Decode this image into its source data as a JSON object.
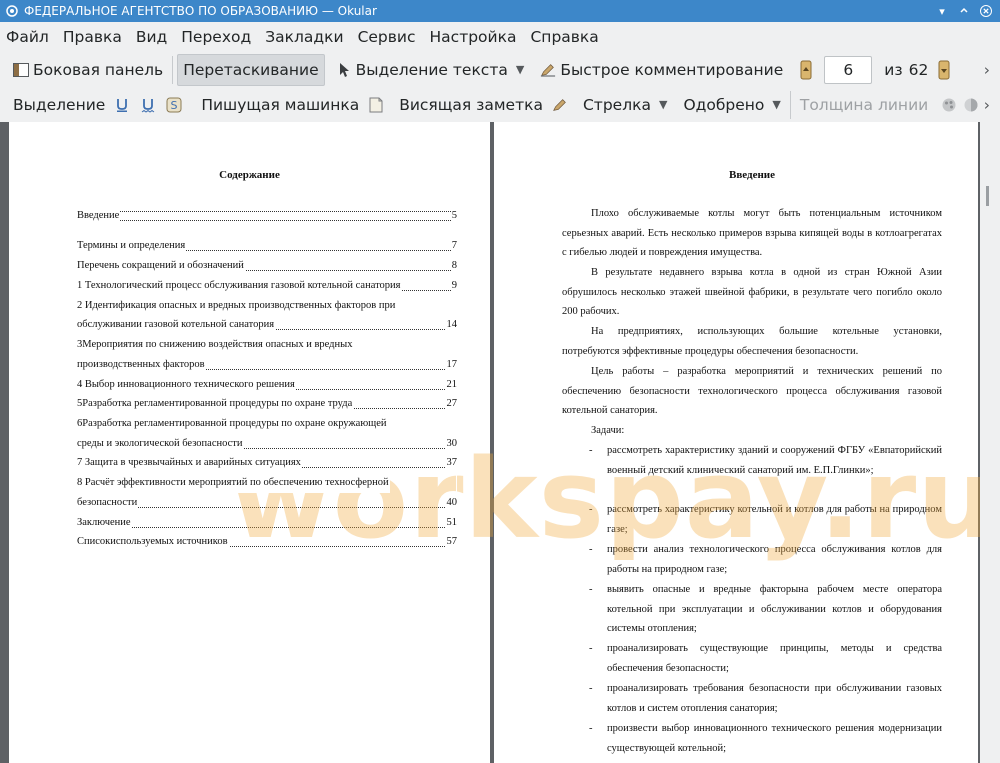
{
  "window": {
    "title": "ФЕДЕРАЛЬНОЕ АГЕНТСТВО ПО ОБРАЗОВАНИЮ — Okular"
  },
  "menu": [
    "Файл",
    "Правка",
    "Вид",
    "Переход",
    "Закладки",
    "Сервис",
    "Настройка",
    "Справка"
  ],
  "toolbar1": {
    "sidebar": "Боковая панель",
    "drag": "Перетаскивание",
    "text_select": "Выделение текста",
    "quick_annot": "Быстрое комментирование",
    "page_current": "6",
    "page_of": "из",
    "page_total": "62"
  },
  "toolbar2": {
    "highlight": "Выделение",
    "typewriter": "Пишущая машинка",
    "popup_note": "Висящая заметка",
    "arrow": "Стрелка",
    "stamp": "Одобрено",
    "line_width": "Толщина линии"
  },
  "left_page": {
    "heading": "Содержание",
    "toc": [
      {
        "label": "Введение",
        "page": "5"
      },
      {
        "label": "",
        "page": ""
      },
      {
        "label": "Термины и определения",
        "page": "7"
      },
      {
        "label": "Перечень сокращений и обозначений",
        "page": "8"
      },
      {
        "label": "1 Технологический процесс обслуживания газовой котельной санатория",
        "page": "9"
      },
      {
        "label": "2 Идентификация опасных и вредных производственных факторов при",
        "page": ""
      },
      {
        "label": "обслуживании газовой котельной санатория",
        "page": "14"
      },
      {
        "label": "3Мероприятия по снижению воздействия опасных и вредных",
        "page": ""
      },
      {
        "label": "производственных факторов",
        "page": "17"
      },
      {
        "label": "4 Выбор инновационного технического решения",
        "page": "21"
      },
      {
        "label": "5Разработка регламентированной процедуры по охране труда",
        "page": "27"
      },
      {
        "label": "6Разработка регламентированной процедуры по охране окружающей",
        "page": ""
      },
      {
        "label": "среды и экологической безопасности",
        "page": "30"
      },
      {
        "label": "7 Защита в чрезвычайных и аварийных ситуациях",
        "page": "37"
      },
      {
        "label": "8 Расчёт эффективности мероприятий по обеспечению техносферной",
        "page": ""
      },
      {
        "label": "безопасности",
        "page": "40"
      },
      {
        "label": "Заключение",
        "page": "51"
      },
      {
        "label": "Списокиспользуемых источников",
        "page": "57"
      }
    ]
  },
  "right_page": {
    "heading": "Введение",
    "p1": "Плохо обслуживаемые котлы могут быть потенциальным источником серьезных аварий. Есть несколько примеров взрыва кипящей воды в котлоагрегатах с гибелью людей и повреждения имущества.",
    "p2": "В результате недавнего взрыва котла в одной из стран Южной Азии обрушилось несколько этажей швейной фабрики, в результате чего погибло около 200 рабочих.",
    "p3": "На предприятиях, использующих большие котельные установки, потребуются эффективные процедуры обеспечения безопасности.",
    "p4": "Цель работы – разработка мероприятий и технических решений по обеспечению безопасности технологического процесса обслуживания газовой котельной санатория.",
    "tasks_label": "Задачи:",
    "bullet_char": "-",
    "tasks": [
      "рассмотреть характеристику зданий и сооружений ФГБУ «Евпаторийский военный детский клинический санаторий им. Е.П.Глинки»;",
      "рассмотреть характеристику котельной и котлов для работы на природном газе;",
      "провести анализ технологического процесса обслуживания котлов для работы на природном газе;",
      "выявить опасные и вредные факторына рабочем месте оператора котельной при эксплуатации и обслуживании котлов и оборудования системы отопления;",
      "проанализировать существующие принципы, методы и средства обеспечения безопасности;",
      "проанализировать требования безопасности при обслуживании газовых котлов и систем отопления санатория;",
      "произвести выбор инновационного технического решения модернизации существующей котельной;"
    ]
  },
  "watermark": "workspay.ru"
}
